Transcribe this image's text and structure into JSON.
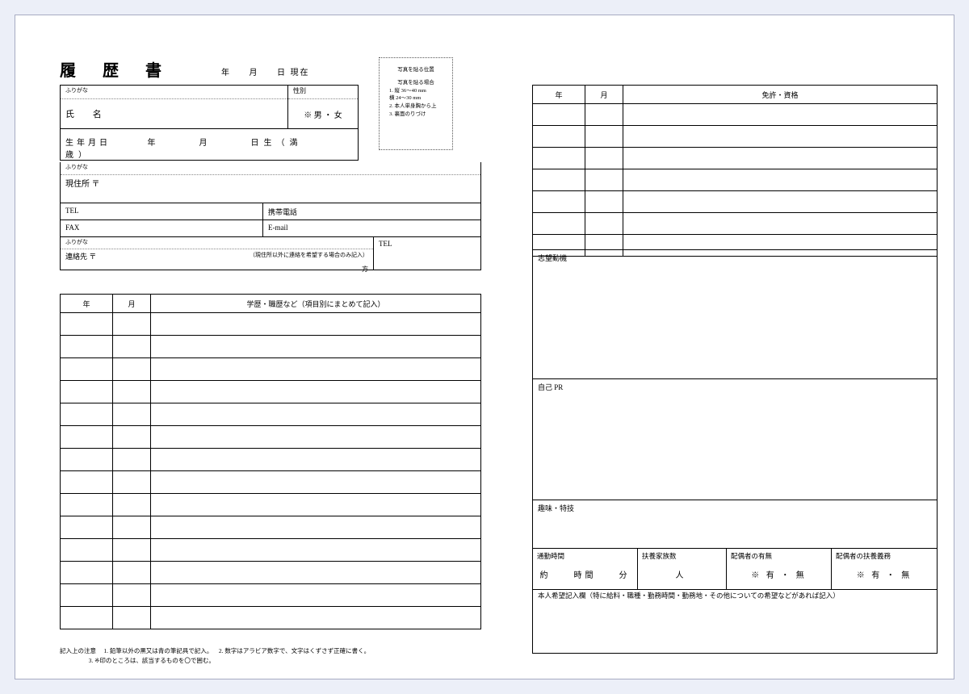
{
  "title": "履 歴 書",
  "date_labels": {
    "year": "年",
    "month": "月",
    "day_current": "日 現在"
  },
  "photo": {
    "line1": "写真を貼る位置",
    "line2": "写真を貼る場合",
    "line3": "1. 縦 36〜40 mm",
    "line4": "   横 24〜30 mm",
    "line5": "2. 本人単身胸から上",
    "line6": "3. 裏面のりづけ"
  },
  "personal": {
    "furigana_label": "ふりがな",
    "name_label": "氏 名",
    "sex_label": "性別",
    "sex_value": "※ 男 ・ 女",
    "dob_label": "生年月日",
    "dob_pattern": "年　　　月　　　日生（満　　　歳）"
  },
  "address": {
    "furigana_label": "ふりがな",
    "current_label": "現住所 〒",
    "tel_label": "TEL",
    "mobile_label": "携帯電話",
    "fax_label": "FAX",
    "email_label": "E-mail",
    "contact_furigana": "ふりがな",
    "contact_label": "連絡先 〒",
    "contact_note": "（現住所以外に連絡を希望する場合のみ記入）",
    "contact_kata": "方",
    "contact_tel": "TEL"
  },
  "history": {
    "year": "年",
    "month": "月",
    "header": "学歴・職歴など（項目別にまとめて記入）",
    "rows": 14
  },
  "notes": {
    "lead": "記入上の注意",
    "n1": "1. 鉛筆以外の黒又は青の筆記具で記入。",
    "n2": "2. 数字はアラビア数字で、文字はくずさず正確に書く。",
    "n3": "3. ※印のところは、該当するものを〇で囲む。"
  },
  "licenses": {
    "year": "年",
    "month": "月",
    "header": "免許・資格",
    "rows": 7
  },
  "motive_label": "志望動機",
  "selfpr_label": "自己 PR",
  "hobby_label": "趣味・特技",
  "conditions": {
    "commute_label": "通勤時間",
    "commute_value": "約　　時間　　分",
    "dependents_label": "扶養家族数",
    "dependents_value": "人",
    "spouse_label": "配偶者の有無",
    "spouse_value": "※ 有 ・ 無",
    "spouse_dep_label": "配偶者の扶養義務",
    "spouse_dep_value": "※ 有 ・ 無"
  },
  "wish_label": "本人希望記入欄（特に給料・職種・勤務時間・勤務地・その他についての希望などがあれば記入）"
}
